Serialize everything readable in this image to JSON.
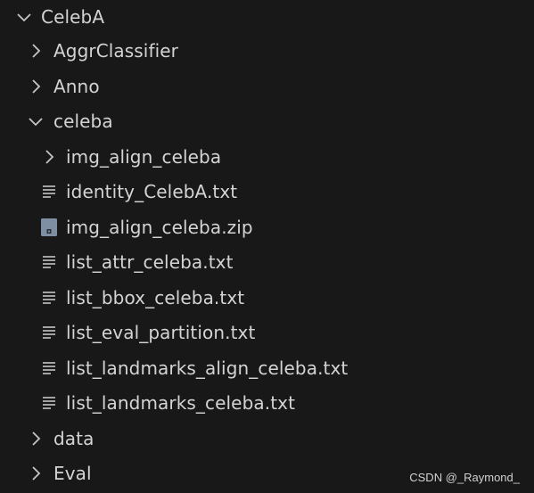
{
  "explorer": {
    "root": {
      "label": "CelebA",
      "expanded": true
    },
    "items": [
      {
        "label": "AggrClassifier",
        "type": "folder",
        "expanded": false
      },
      {
        "label": "Anno",
        "type": "folder",
        "expanded": false
      },
      {
        "label": "celeba",
        "type": "folder",
        "expanded": true
      },
      {
        "label": "img_align_celeba",
        "type": "folder",
        "expanded": false
      },
      {
        "label": "identity_CelebA.txt",
        "type": "text-file"
      },
      {
        "label": "img_align_celeba.zip",
        "type": "zip-file"
      },
      {
        "label": "list_attr_celeba.txt",
        "type": "text-file"
      },
      {
        "label": "list_bbox_celeba.txt",
        "type": "text-file"
      },
      {
        "label": "list_eval_partition.txt",
        "type": "text-file"
      },
      {
        "label": "list_landmarks_align_celeba.txt",
        "type": "text-file"
      },
      {
        "label": "list_landmarks_celeba.txt",
        "type": "text-file"
      },
      {
        "label": "data",
        "type": "folder",
        "expanded": false
      },
      {
        "label": "Eval",
        "type": "folder",
        "expanded": false
      }
    ]
  },
  "watermark": "CSDN @_Raymond_",
  "colors": {
    "background": "#181818",
    "text": "#d4d4d4",
    "icon": "#c5c5c5",
    "zip_icon": "#7e8fa3"
  }
}
